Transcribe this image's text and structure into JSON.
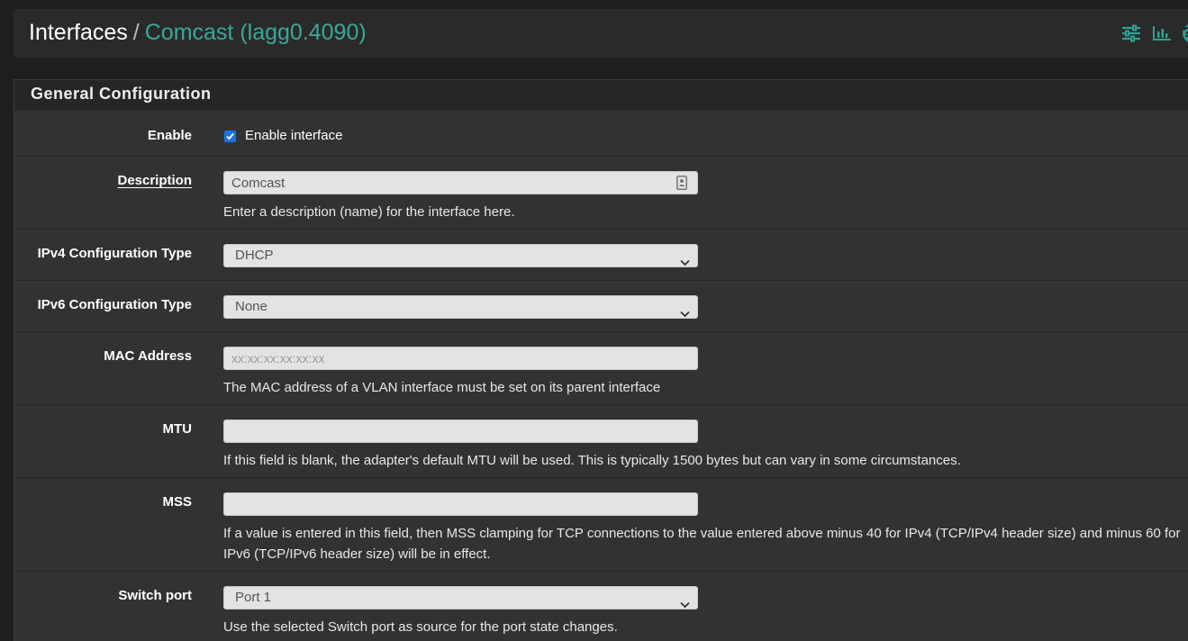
{
  "header": {
    "breadcrumb_root": "Interfaces",
    "breadcrumb_separator": "/",
    "breadcrumb_current": "Comcast (lagg0.4090)",
    "icons": [
      "sliders-icon",
      "bar-chart-icon",
      "help-icon"
    ],
    "help_glyph": "?"
  },
  "panel": {
    "title": "General Configuration"
  },
  "form": {
    "enable": {
      "label": "Enable",
      "checkbox_label": "Enable interface",
      "checked": true
    },
    "description": {
      "label": "Description",
      "value": "Comcast",
      "help": "Enter a description (name) for the interface here."
    },
    "ipv4": {
      "label": "IPv4 Configuration Type",
      "value": "DHCP"
    },
    "ipv6": {
      "label": "IPv6 Configuration Type",
      "value": "None"
    },
    "mac": {
      "label": "MAC Address",
      "value": "",
      "placeholder": "xx:xx:xx:xx:xx:xx",
      "help": "The MAC address of a VLAN interface must be set on its parent interface"
    },
    "mtu": {
      "label": "MTU",
      "value": "",
      "help": "If this field is blank, the adapter's default MTU will be used. This is typically 1500 bytes but can vary in some circumstances."
    },
    "mss": {
      "label": "MSS",
      "value": "",
      "help": "If a value is entered in this field, then MSS clamping for TCP connections to the value entered above minus 40 for IPv4 (TCP/IPv4 header size) and minus 60 for IPv6 (TCP/IPv6 header size) will be in effect."
    },
    "switch_port": {
      "label": "Switch port",
      "value": "Port 1",
      "help": "Use the selected Switch port as source for the port state changes."
    }
  },
  "colors": {
    "accent": "#3aa89a",
    "background": "#1e1e1e",
    "panel": "#323232",
    "checkbox": "#1a73e8"
  }
}
